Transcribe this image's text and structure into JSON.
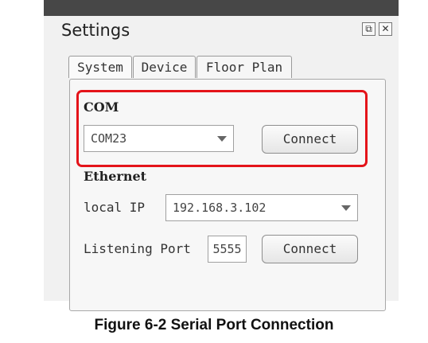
{
  "window": {
    "title": "Settings",
    "restore_symbol": "⧉",
    "close_symbol": "✕"
  },
  "tabs": [
    {
      "label": "System",
      "active": true
    },
    {
      "label": "Device",
      "active": false
    },
    {
      "label": "Floor Plan",
      "active": false
    }
  ],
  "com": {
    "section_label": "COM",
    "port_value": "COM23",
    "connect_label": "Connect"
  },
  "ethernet": {
    "section_label": "Ethernet",
    "local_ip_label": "local IP",
    "local_ip_value": "192.168.3.102",
    "listening_port_label": "Listening Port",
    "listening_port_value": "5555",
    "connect_label": "Connect"
  },
  "caption": "Figure 6-2 Serial Port Connection",
  "colors": {
    "highlight": "#e4141a",
    "title_bar": "#474747"
  }
}
